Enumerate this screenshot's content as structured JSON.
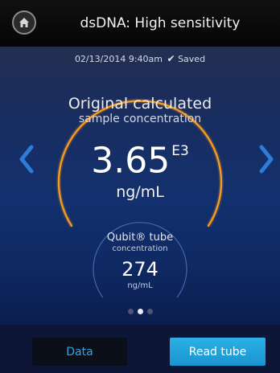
{
  "header": {
    "title": "dsDNA: High sensitivity",
    "home_icon": "home-icon"
  },
  "status": {
    "datetime": "02/13/2014 9:40am",
    "saved_label": "Saved"
  },
  "result": {
    "label_line1": "Original calculated",
    "label_line2": "sample concentration",
    "value": "3.65",
    "exponent": "E3",
    "unit": "ng/mL"
  },
  "qubit": {
    "label": "Qubit® tube",
    "sublabel": "concentration",
    "value": "274",
    "unit": "ng/mL"
  },
  "pager": {
    "page_count": 3,
    "active_index": 1
  },
  "footer": {
    "data_label": "Data",
    "read_label": "Read tube"
  },
  "colors": {
    "accent_blue": "#27a9e0",
    "arc_orange": "#f39a1f",
    "nav_blue": "#2c7dd8"
  }
}
